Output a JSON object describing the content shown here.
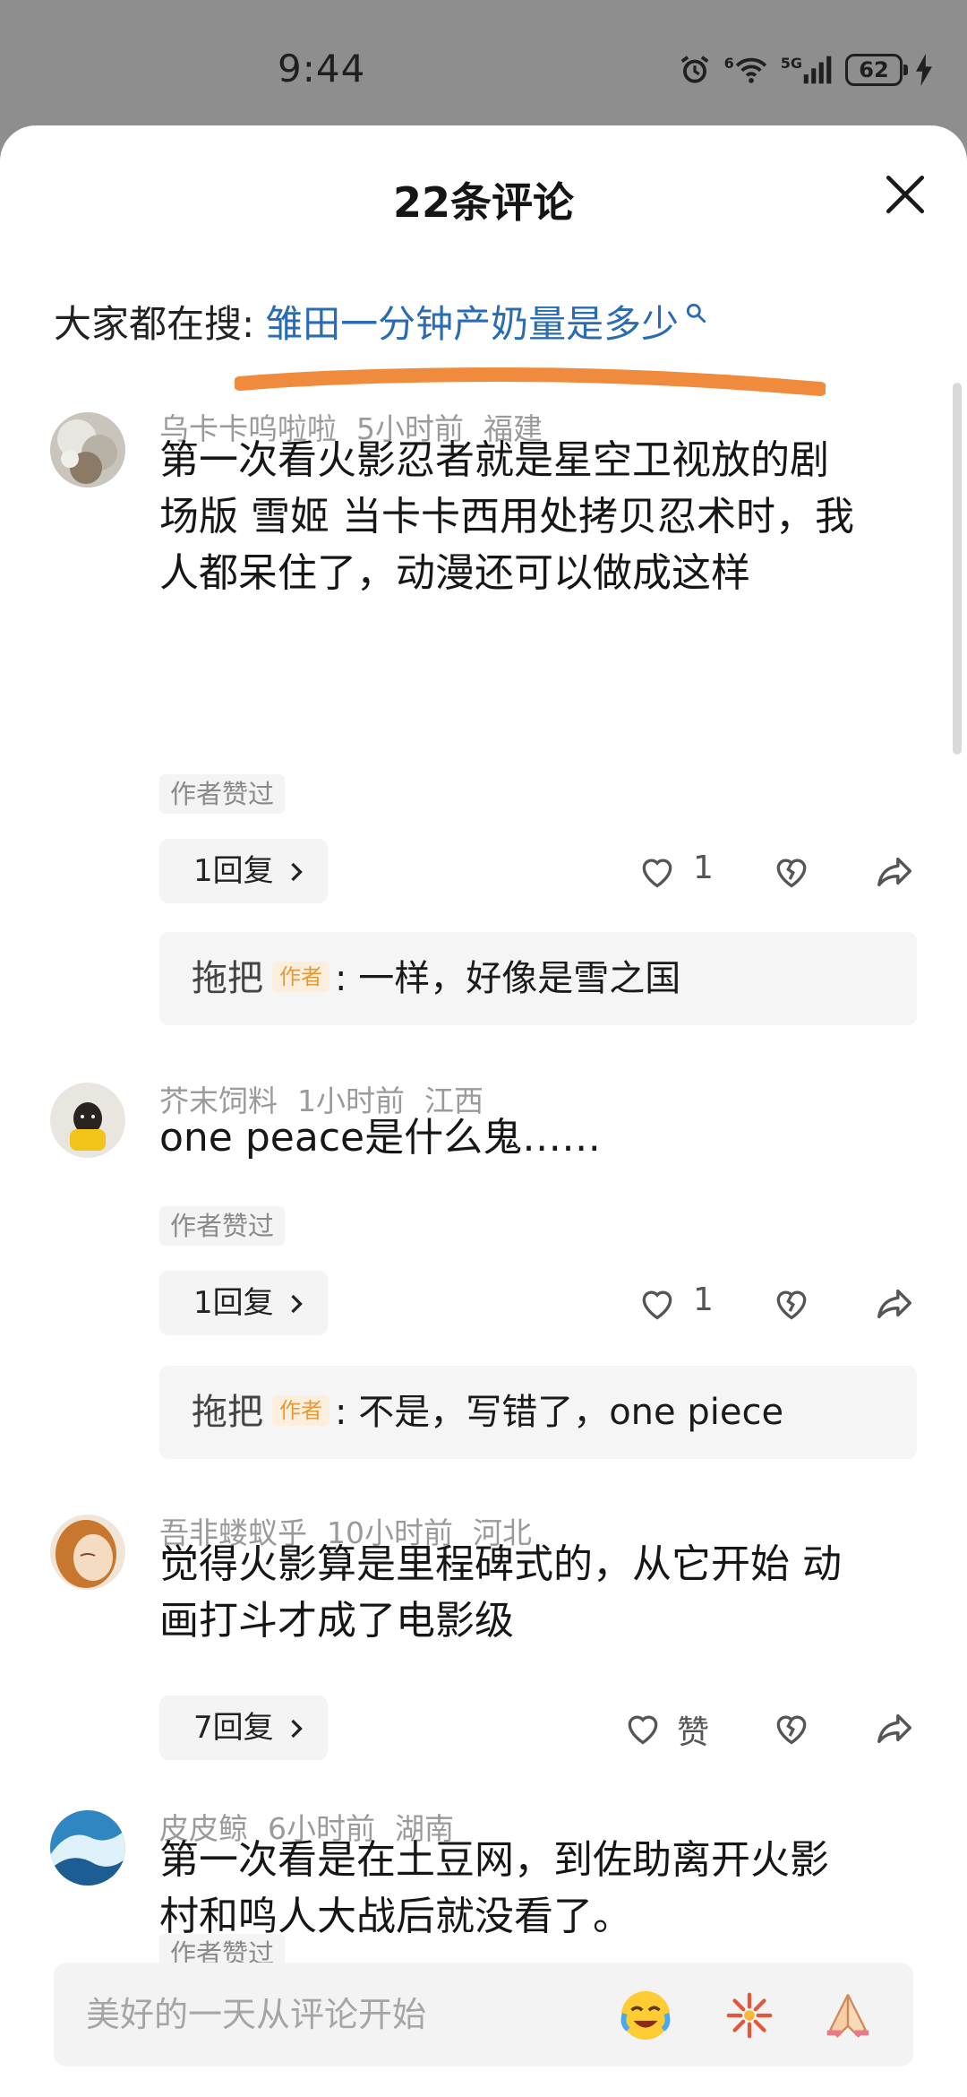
{
  "status_bar": {
    "time": "9:44",
    "signal_label": "5G",
    "wifi_label": "6",
    "battery": "62"
  },
  "sheet": {
    "title": "22条评论"
  },
  "hot_search": {
    "label": "大家都在搜:",
    "query": "雏田一分钟产奶量是多少"
  },
  "comments": [
    {
      "user": "乌卡卡呜啦啦",
      "time": "5小时前",
      "location": "福建",
      "lines": [
        "第一次看火影忍者就是星空卫视放的剧",
        "场版 雪姬 当卡卡西用处拷贝忍术时，我",
        "人都呆住了，动漫还可以做成这样"
      ],
      "author_liked": "作者赞过",
      "replies": "1回复",
      "likes": "1",
      "reply_preview": {
        "name": "拖把",
        "tag": "作者",
        "text": ": 一样，好像是雪之国"
      }
    },
    {
      "user": "芥末饲料",
      "time": "1小时前",
      "location": "江西",
      "lines": [
        "one peace是什么鬼……"
      ],
      "author_liked": "作者赞过",
      "replies": "1回复",
      "likes": "1",
      "reply_preview": {
        "name": "拖把",
        "tag": "作者",
        "text": ": 不是，写错了，one piece"
      }
    },
    {
      "user": "吾非蝼蚁乎",
      "time": "10小时前",
      "location": "河北",
      "lines": [
        "觉得火影算是里程碑式的，从它开始 动",
        "画打斗才成了电影级"
      ],
      "replies": "7回复",
      "likes": "赞"
    },
    {
      "user": "皮皮鲸",
      "time": "6小时前",
      "location": "湖南",
      "lines": [
        "第一次看是在土豆网，到佐助离开火影",
        "村和鸣人大战后就没看了。"
      ],
      "author_liked": "作者赞过"
    }
  ],
  "input": {
    "placeholder": "美好的一天从评论开始"
  },
  "icons": {
    "close": "close-icon",
    "like": "heart-outline-icon",
    "dislike": "broken-heart-icon",
    "share": "share-arrow-icon",
    "chevron": "chevron-right-icon",
    "search": "search-icon",
    "emoji_1": "crying-laugh-emoji",
    "emoji_2": "fireworks-emoji",
    "emoji_3": "praying-hands-emoji"
  },
  "colors": {
    "accent_link": "#2a6bb5",
    "author_tag": "#e39a3a",
    "highlight_stroke": "#f08a3c"
  }
}
